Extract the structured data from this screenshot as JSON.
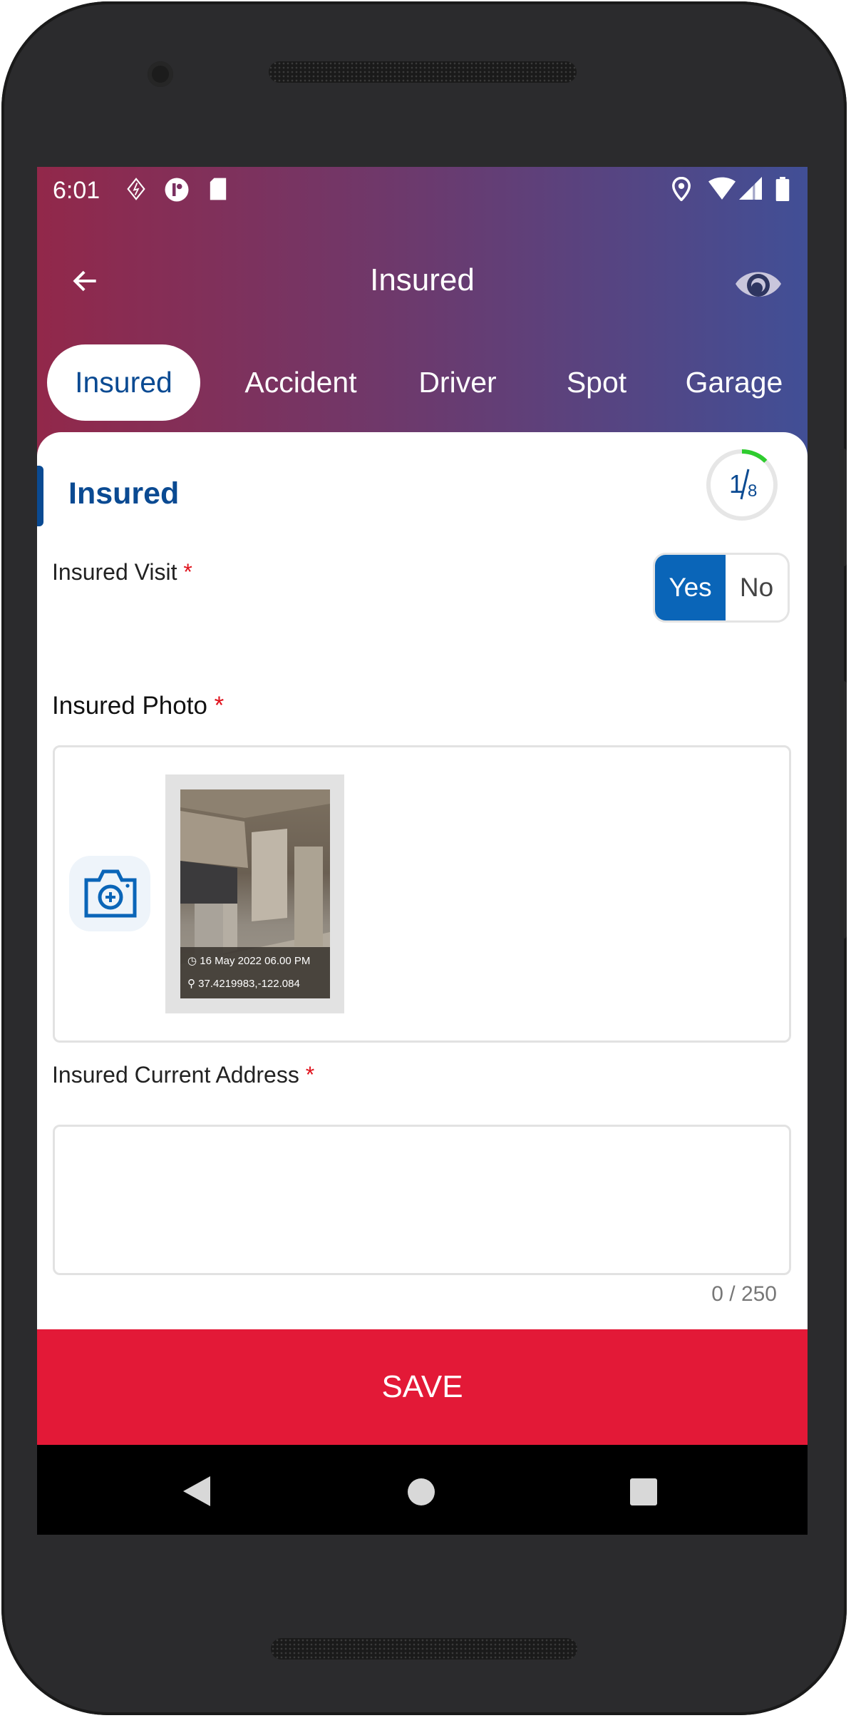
{
  "status_bar": {
    "time": "6:01",
    "left_icons": [
      "bolt-shield-icon",
      "p-circle-icon",
      "sd-card-icon"
    ],
    "right_icons": [
      "location-icon",
      "wifi-icon",
      "signal-icon",
      "battery-icon"
    ]
  },
  "header": {
    "title": "Insured",
    "back_icon": "arrow-left-icon",
    "right_icon": "eye-icon"
  },
  "tabs": [
    {
      "label": "Insured",
      "active": true
    },
    {
      "label": "Accident"
    },
    {
      "label": "Driver"
    },
    {
      "label": "Spot"
    },
    {
      "label": "Garage"
    }
  ],
  "section": {
    "title": "Insured",
    "progress": {
      "current": "1",
      "total": "8",
      "fraction": 0.125,
      "color": "#2ecc2e"
    }
  },
  "fields": {
    "visit": {
      "label": "Insured Visit",
      "required": "*",
      "options": [
        "Yes",
        "No"
      ],
      "selected": "Yes"
    },
    "photo": {
      "label": "Insured Photo",
      "required": "*",
      "photos": [
        {
          "date": "16 May 2022 06.00 PM",
          "coords": "37.4219983,-122.084"
        }
      ]
    },
    "address": {
      "label": "Insured Current Address",
      "required": "*",
      "value": "",
      "counter": "0 / 250"
    }
  },
  "save_label": "SAVE",
  "colors": {
    "accent": "#0a4a92",
    "toggle": "#0a65b8",
    "save": "#e31937",
    "gradient_start": "#92284a",
    "gradient_end": "#414f96"
  }
}
